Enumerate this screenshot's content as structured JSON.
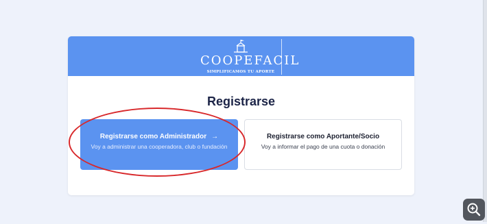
{
  "brand": {
    "name": "COOPEFACIL",
    "tagline": "SIMPLIFICAMOS TU APORTE"
  },
  "page": {
    "title": "Registrarse"
  },
  "options": {
    "admin": {
      "title": "Registrarse como Administrador",
      "arrow": "→",
      "description": "Voy a administrar una cooperadora, club o fundación"
    },
    "member": {
      "title": "Registrarse como Aportante/Socio",
      "description": "Voy a informar el pago de una cuota o donación"
    }
  },
  "icons": {
    "logo": "school-house-icon",
    "zoom": "zoom-in-icon"
  },
  "colors": {
    "background": "#eef2fb",
    "primary": "#5b93f0",
    "title_text": "#1c2447",
    "annotation_circle": "#d8282b"
  }
}
